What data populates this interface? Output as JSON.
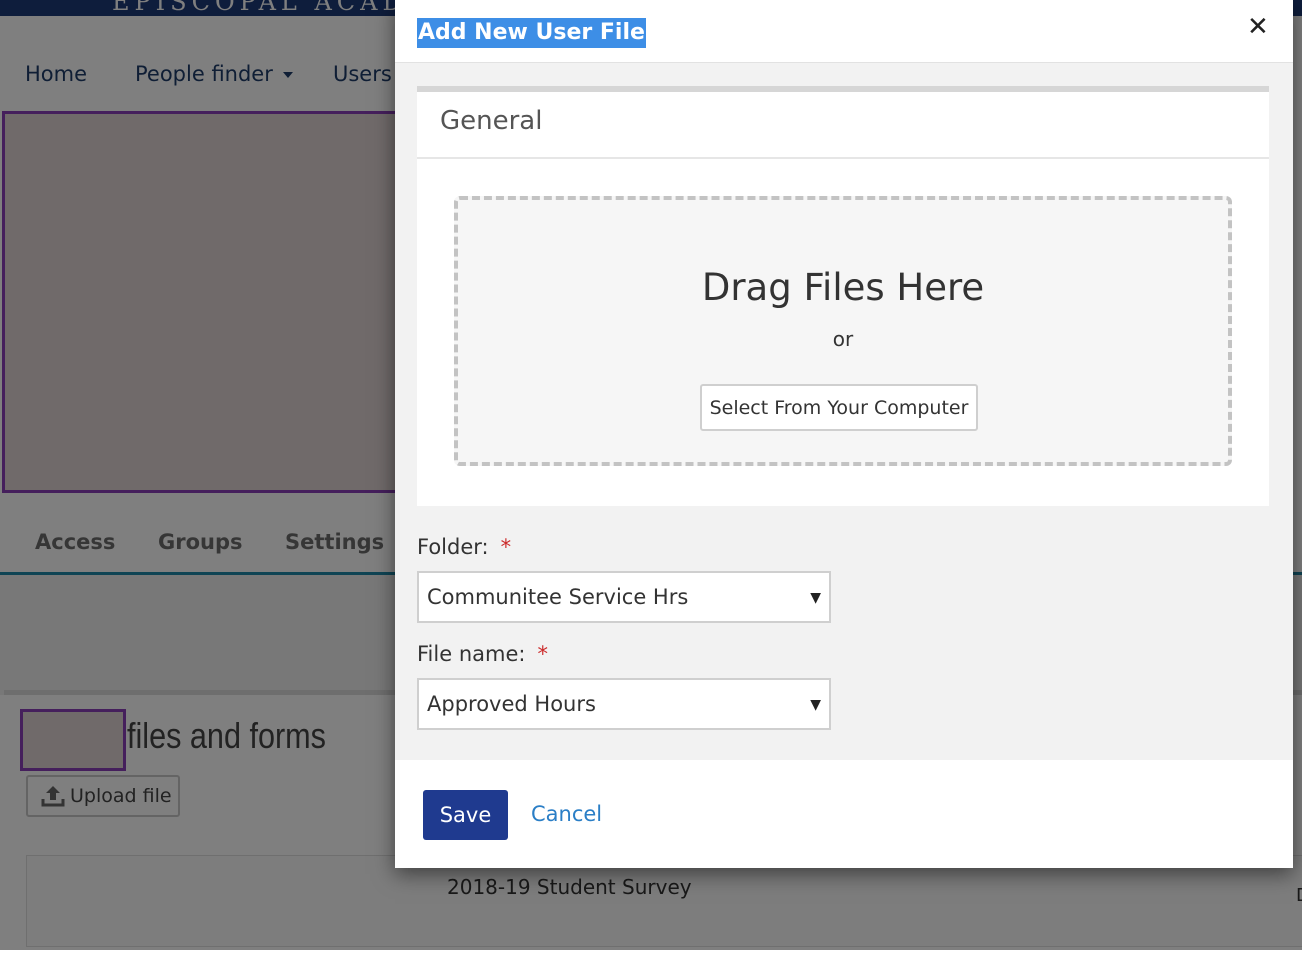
{
  "page": {
    "logo_text": "EPISCOPAL ACADEMY",
    "nav": [
      {
        "label": "Home"
      },
      {
        "label": "People finder",
        "has_caret": true
      },
      {
        "label": "Users"
      }
    ],
    "tabs": [
      {
        "label": "Access"
      },
      {
        "label": "Groups"
      },
      {
        "label": "Settings"
      }
    ],
    "files": {
      "title": "files and forms",
      "upload_label": "Upload file",
      "survey_item": "2018-19 Student Survey",
      "edge_char": "D"
    }
  },
  "modal": {
    "title": "Add New User File",
    "close_icon": "close-icon",
    "general": {
      "title": "General",
      "drag_title": "Drag Files Here",
      "or_text": "or",
      "select_button": "Select From Your Computer"
    },
    "folder": {
      "label": "Folder:",
      "required_mark": "*",
      "value": "Communitee Service Hrs"
    },
    "file_name": {
      "label": "File name:",
      "required_mark": "*",
      "value": "Approved Hours"
    },
    "actions": {
      "save": "Save",
      "cancel": "Cancel"
    }
  },
  "colors": {
    "primary": "#1f3a8f",
    "link": "#2a7ec6",
    "required": "#cc2b2b",
    "title_highlight": "#3d8ee6",
    "accent_border": "#8a3fb8"
  }
}
